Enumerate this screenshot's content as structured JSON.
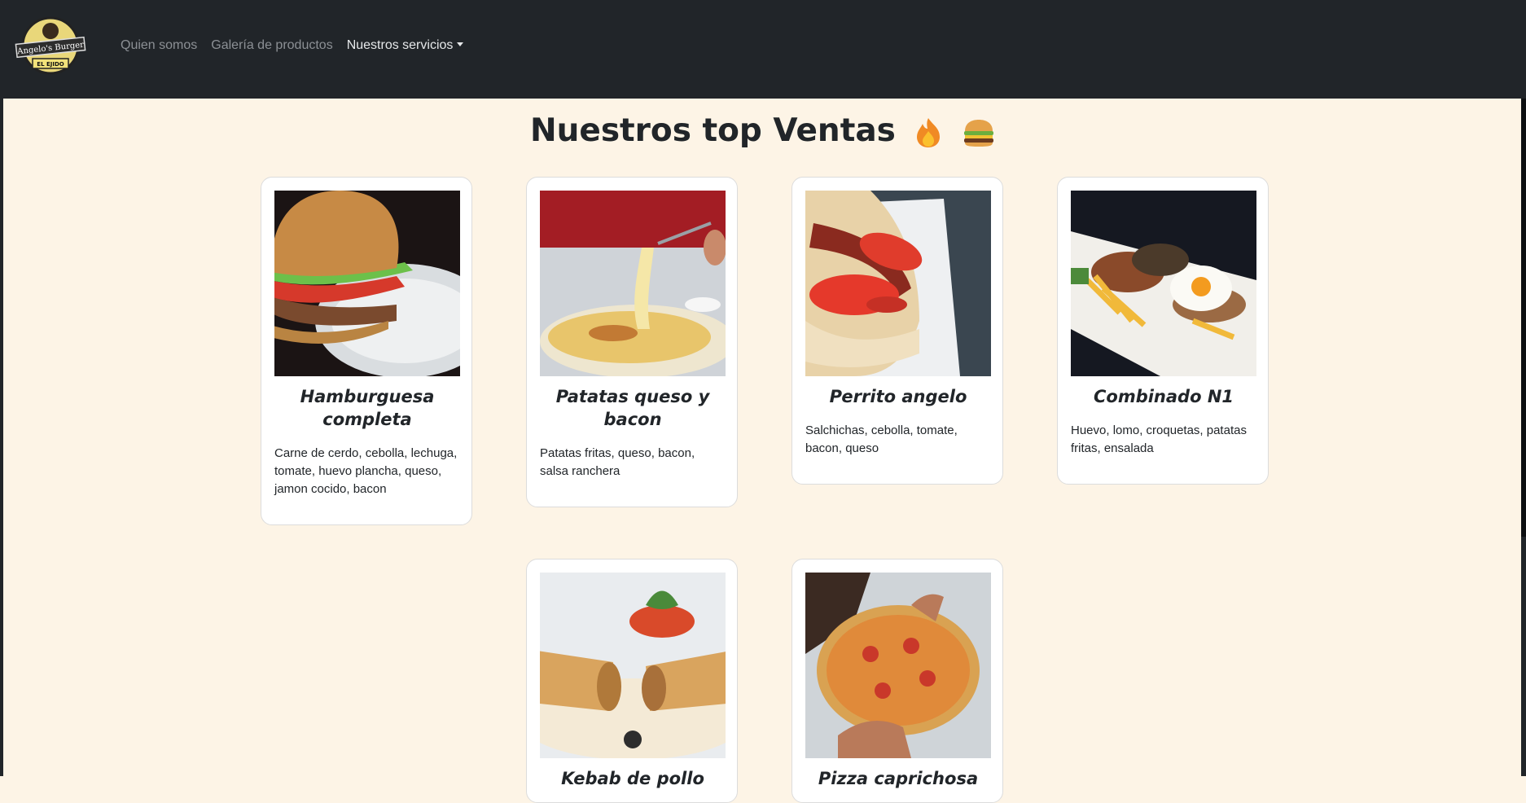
{
  "brand": {
    "logo_line1": "Angelo's Burger",
    "logo_line2": "EL EJIDO"
  },
  "nav": {
    "items": [
      {
        "label": "Quien somos"
      },
      {
        "label": "Galería de productos"
      },
      {
        "label": "Nuestros servicios"
      }
    ]
  },
  "page": {
    "title": "Nuestros top Ventas",
    "title_icons": [
      "fire-icon",
      "burger-icon"
    ]
  },
  "products": [
    {
      "name": "Hamburguesa completa",
      "description": "Carne de cerdo, cebolla, lechuga, tomate, huevo plancha, queso, jamon cocido, bacon"
    },
    {
      "name": "Patatas queso y bacon",
      "description": "Patatas fritas, queso, bacon, salsa ranchera"
    },
    {
      "name": "Perrito angelo",
      "description": "Salchichas, cebolla, tomate, bacon, queso"
    },
    {
      "name": "Combinado N1",
      "description": "Huevo, lomo, croquetas, patatas fritas, ensalada"
    },
    {
      "name": "Kebab de pollo",
      "description": ""
    },
    {
      "name": "Pizza caprichosa",
      "description": ""
    }
  ],
  "colors": {
    "navbar": "#212529",
    "page_background": "#fdf4e6",
    "card_background": "#ffffff"
  }
}
